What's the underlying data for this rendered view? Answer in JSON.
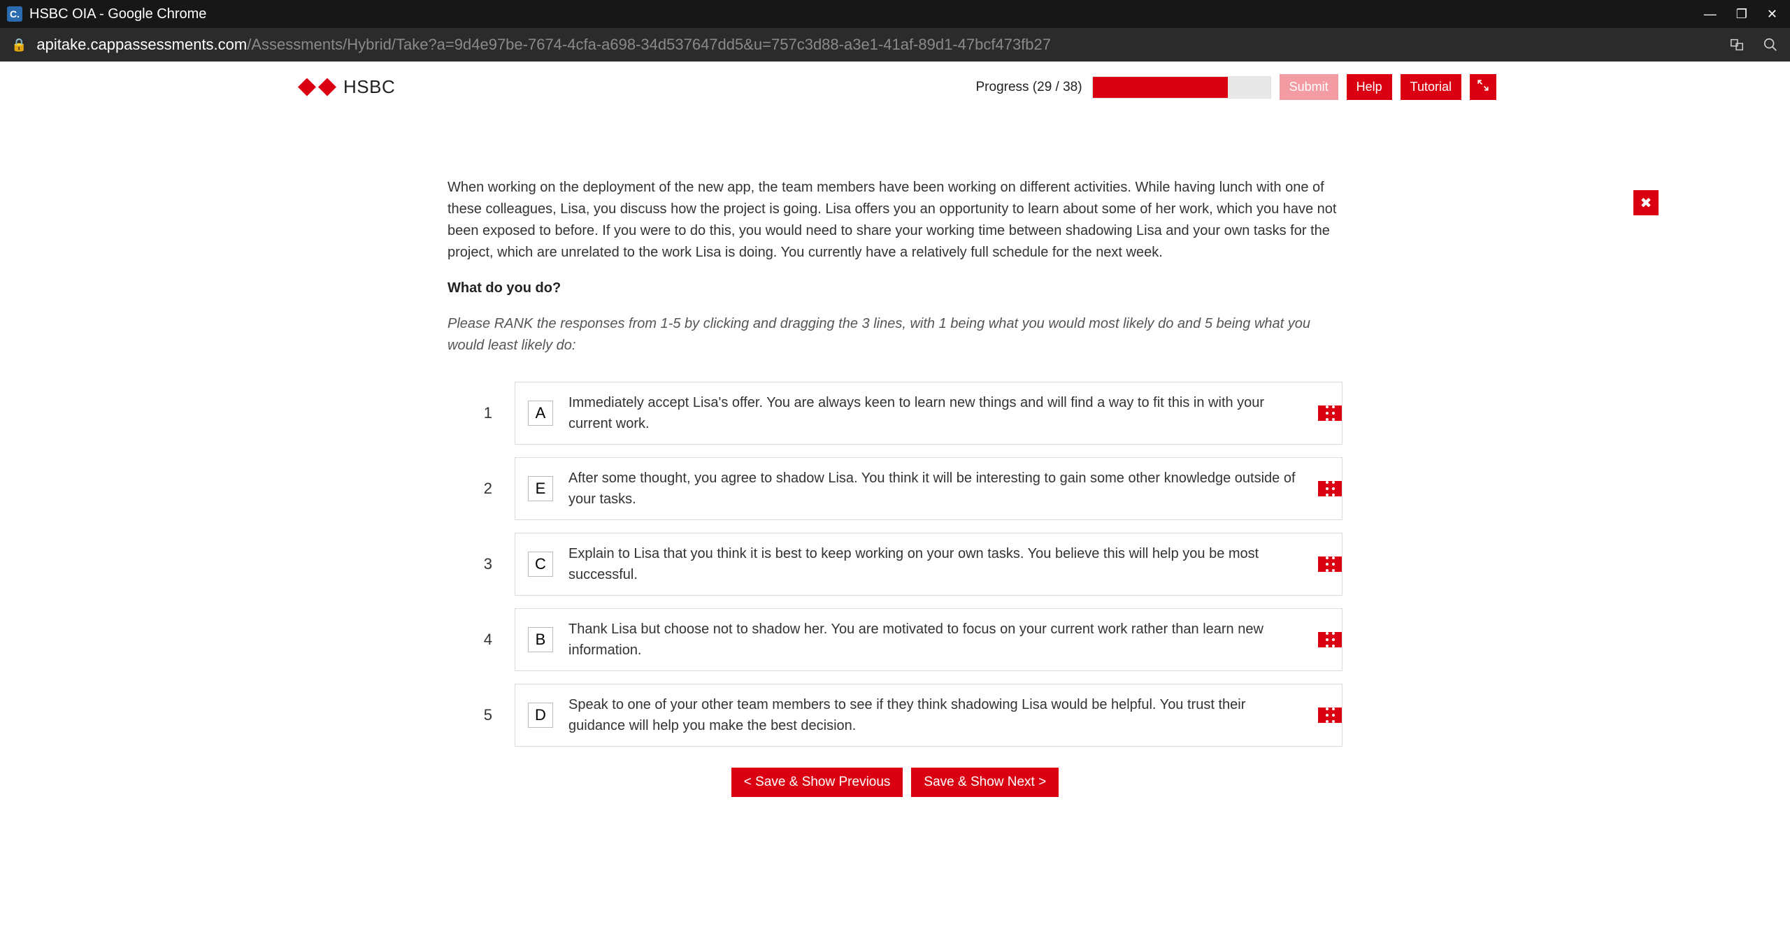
{
  "window": {
    "title": "HSBC OIA - Google Chrome",
    "favicon_letter": "C."
  },
  "address": {
    "host": "apitake.cappassessments.com",
    "path": "/Assessments/Hybrid/Take?a=9d4e97be-7674-4cfa-a698-34d537647dd5&u=757c3d88-a3e1-41af-89d1-47bcf473fb27"
  },
  "brand": {
    "name": "HSBC"
  },
  "progress": {
    "label": "Progress (29 / 38)",
    "percent": 76
  },
  "buttons": {
    "submit": "Submit",
    "help": "Help",
    "tutorial": "Tutorial",
    "prev": "< Save & Show Previous",
    "next": "Save & Show Next >"
  },
  "question": {
    "scenario": "When working on the deployment of the new app, the team members have been working on different activities. While having lunch with one of these colleagues, Lisa, you discuss how the project is going. Lisa offers you an opportunity to learn about some of her work, which you have not been exposed to before. If you were to do this, you would need to share your working time between shadowing Lisa and your own tasks for the project, which are unrelated to the work Lisa is doing. You currently have a relatively full schedule for the next week.",
    "prompt": "What do you do?",
    "instructions": "Please RANK the responses from 1-5 by clicking and dragging the 3 lines, with 1 being what you would most likely do and 5 being what you would least likely do:",
    "options": [
      {
        "rank": "1",
        "letter": "A",
        "text": "Immediately accept Lisa's offer. You are always keen to learn new things and will find a way to fit this in with your current work."
      },
      {
        "rank": "2",
        "letter": "E",
        "text": "After some thought, you agree to shadow Lisa. You think it will be interesting to gain some other knowledge outside of your tasks."
      },
      {
        "rank": "3",
        "letter": "C",
        "text": "Explain to Lisa that you think it is best to keep working on your own tasks. You believe this will help you be most successful."
      },
      {
        "rank": "4",
        "letter": "B",
        "text": "Thank Lisa but choose not to shadow her. You are motivated to focus on your current work rather than learn new information."
      },
      {
        "rank": "5",
        "letter": "D",
        "text": "Speak to one of your other team members to see if they think shadowing Lisa would be helpful. You trust their guidance will help you make the best decision."
      }
    ]
  }
}
